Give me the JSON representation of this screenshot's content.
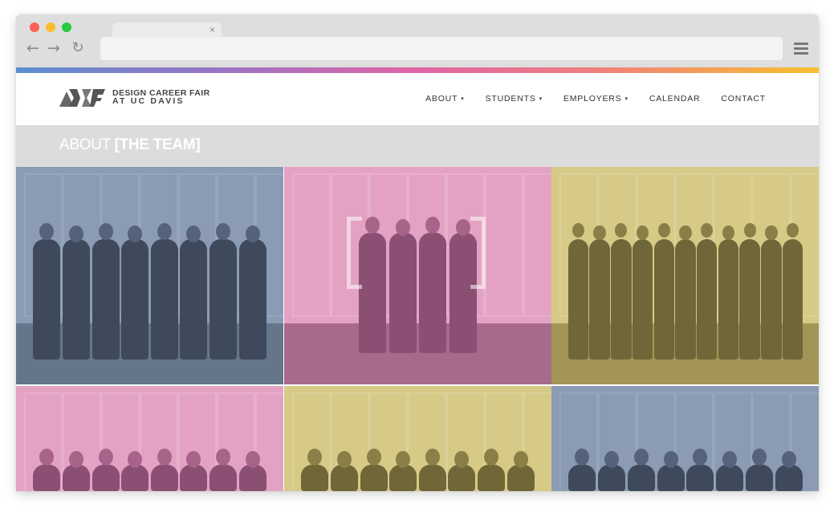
{
  "browser": {
    "tab_close": "×",
    "back_icon": "arrow-left-icon",
    "forward_icon": "arrow-right-icon",
    "reload_icon": "reload-icon",
    "menu_icon": "hamburger-icon",
    "url": ""
  },
  "brand": {
    "line1": "DESIGN CAREER FAIR",
    "line2": "AT UC DAVIS"
  },
  "nav": {
    "items": [
      {
        "label": "ABOUT",
        "dropdown": true
      },
      {
        "label": "STUDENTS",
        "dropdown": true
      },
      {
        "label": "EMPLOYERS",
        "dropdown": true
      },
      {
        "label": "CALENDAR",
        "dropdown": false
      },
      {
        "label": "CONTACT",
        "dropdown": false
      }
    ],
    "caret": "▾"
  },
  "page": {
    "title_light": "ABOUT",
    "title_bold": "[THE TEAM]"
  },
  "colors": {
    "gradient": [
      "#5b8fcf",
      "#9a74c4",
      "#e064a6",
      "#f07e7e",
      "#f6bf2f"
    ],
    "blue_tint": "#7f93ad",
    "pink_tint": "#d98cb6",
    "yellow_tint": "#c6b86a"
  },
  "gallery": [
    {
      "tint": "blue",
      "people": 8
    },
    {
      "tint": "pink",
      "people": 4
    },
    {
      "tint": "yellow",
      "people": 11
    },
    {
      "tint": "pink",
      "people": 8
    },
    {
      "tint": "yellow",
      "people": 8
    },
    {
      "tint": "blue",
      "people": 8
    }
  ]
}
